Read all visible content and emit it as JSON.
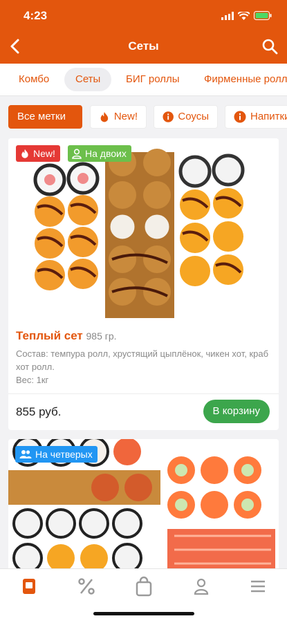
{
  "status_bar": {
    "time": "4:23"
  },
  "header": {
    "title": "Сеты"
  },
  "categories": [
    {
      "label": "Комбо"
    },
    {
      "label": "Сеты"
    },
    {
      "label": "БИГ роллы"
    },
    {
      "label": "Фирменные роллы"
    }
  ],
  "tags": [
    {
      "label": "Все метки",
      "icon": "none"
    },
    {
      "label": "New!",
      "icon": "flame-icon"
    },
    {
      "label": "Соусы",
      "icon": "info-icon"
    },
    {
      "label": "Напитки",
      "icon": "info-icon"
    }
  ],
  "products": [
    {
      "badges": [
        {
          "label": "New!",
          "icon": "flame-icon",
          "color": "#e53935"
        },
        {
          "label": "На двоих",
          "icon": "person-icon",
          "color": "#6cbf4b"
        }
      ],
      "name": "Теплый сет",
      "weight": "985 гр.",
      "description": "Состав: темпура ролл, хрустящий цыплёнок, чикен хот, краб хот ролл.",
      "weight_line": "Вес: 1кг",
      "price": "855 руб.",
      "cart_label": "В корзину"
    },
    {
      "badges": [
        {
          "label": "На четверых",
          "icon": "group-icon",
          "color": "#2196f3"
        }
      ]
    }
  ],
  "colors": {
    "accent": "#e3560d",
    "cart_button": "#3ca64c"
  }
}
